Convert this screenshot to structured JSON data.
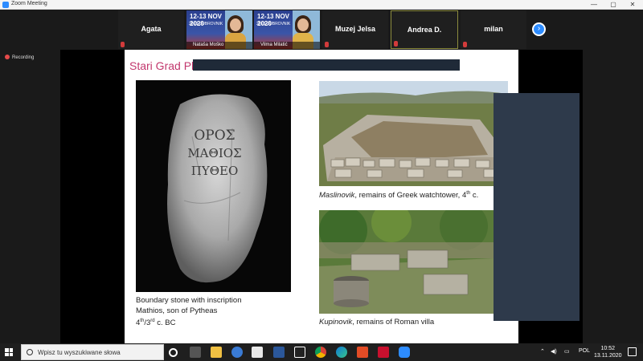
{
  "window": {
    "title": "Zoom Meeting",
    "controls": [
      "—",
      "▢",
      "✕"
    ]
  },
  "gallery": {
    "tiles": [
      {
        "name": "Agata"
      },
      {
        "name": "Muzej Jelsa"
      },
      {
        "name": "Andrea D."
      },
      {
        "name": "milan"
      }
    ],
    "video_tiles": [
      {
        "caption": "Nataša Moško",
        "banner_title": "12-13 NOV 2020",
        "banner_sub": "2018 DUBROVNIK"
      },
      {
        "caption": "Vilma Milatić",
        "banner_title": "12-13 NOV 2020",
        "banner_sub": "2018 DUBROVNIK"
      }
    ]
  },
  "recording": {
    "label": "Recording"
  },
  "slide": {
    "title": "Stari Grad Pla",
    "left_caption": {
      "line1": "Boundary stone with inscription",
      "line2": "Mathios, son of Pytheas",
      "line3_a": "4",
      "line3_sup1": "th",
      "line3_b": "/3",
      "line3_sup2": "rd",
      "line3_c": " c. BC"
    },
    "stone_inscription": [
      "ΟΡΟΣ",
      "ΜΑΘΙΟΣ",
      "ΠΥΘΕΟ"
    ],
    "photo1_caption": {
      "place": "Maslinovik",
      "text": ", remains of Greek watchtower, 4",
      "sup": "th",
      "end": " c."
    },
    "photo2_caption": {
      "place": "Kupinovik",
      "text": ", remains of Roman villa"
    }
  },
  "taskbar": {
    "search_placeholder": "Wpisz tu wyszukiwane słowa",
    "language": "POL",
    "time": "10:52",
    "date": "13.11.2020",
    "app_icons": [
      "task-view-icon",
      "file-explorer-icon",
      "edge-icon",
      "app-icon",
      "word-icon",
      "app-icon-2",
      "chrome-icon",
      "edge-new-icon",
      "acrobat-icon",
      "pdf-icon",
      "zoom-icon"
    ]
  }
}
